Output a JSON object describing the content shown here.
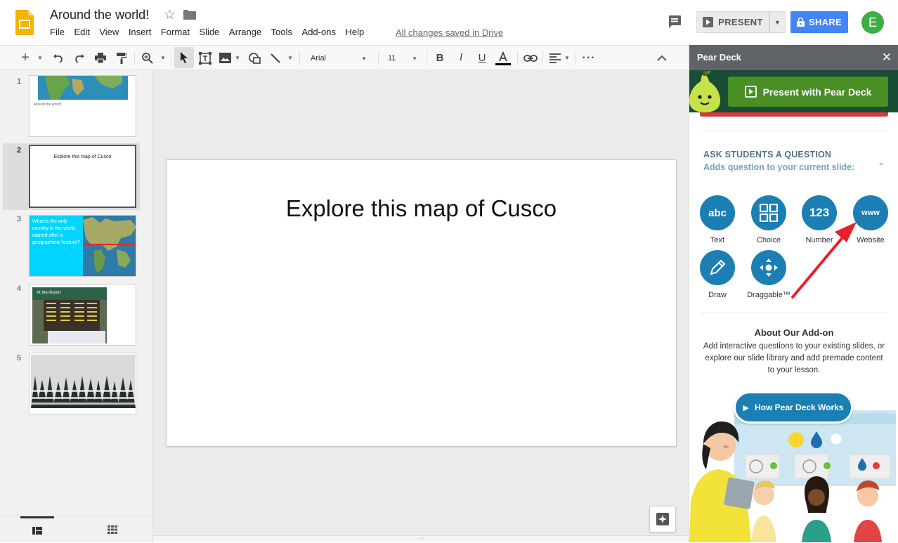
{
  "app": {
    "title": "Around the world!",
    "saved_status": "All changes saved in Drive",
    "menu": [
      "File",
      "Edit",
      "View",
      "Insert",
      "Format",
      "Slide",
      "Arrange",
      "Tools",
      "Add-ons",
      "Help"
    ],
    "present_label": "PRESENT",
    "share_label": "SHARE",
    "avatar_initial": "E"
  },
  "toolbar": {
    "font": "Arial",
    "font_size": "11",
    "icons": [
      "new-slide-icon",
      "undo-icon",
      "redo-icon",
      "print-icon",
      "paint-format-icon",
      "zoom-icon",
      "select-icon",
      "text-box-icon",
      "image-icon",
      "shape-icon",
      "line-icon",
      "bold-icon",
      "italic-icon",
      "underline-icon",
      "text-color-icon",
      "link-icon",
      "align-icon",
      "more-icon",
      "collapse-icon"
    ]
  },
  "filmstrip": {
    "slides": [
      {
        "number": "1",
        "text": "Around the world!"
      },
      {
        "number": "2",
        "text": "Explore this map of Cusco"
      },
      {
        "number": "3",
        "text": "What is the only country in the world named after a geographical feature?"
      },
      {
        "number": "4",
        "text": "At the Airport"
      },
      {
        "number": "5",
        "text": ""
      }
    ],
    "selected": 2
  },
  "canvas": {
    "slide_title": "Explore this map of Cusco"
  },
  "sidepanel": {
    "title": "Pear Deck",
    "present_button": "Present with Pear Deck",
    "ask_title": "ASK STUDENTS A QUESTION",
    "ask_subtitle": "Adds question to your current slide:",
    "question_types": [
      {
        "label": "Text",
        "glyph": "abc"
      },
      {
        "label": "Choice",
        "glyph": "grid"
      },
      {
        "label": "Number",
        "glyph": "123"
      },
      {
        "label": "Website",
        "glyph": "www"
      },
      {
        "label": "Draw",
        "glyph": "pencil"
      },
      {
        "label": "Draggable™",
        "glyph": "move"
      }
    ],
    "about_title": "About Our Add-on",
    "about_text": "Add interactive questions to your existing slides, or explore our slide library and add premade content to your lesson.",
    "how_button": "How Pear Deck Works"
  },
  "colors": {
    "share_blue": "#4285f4",
    "pear_green": "#4a8e26",
    "question_blue": "#1b7fb4",
    "annotation_red": "#e8202a"
  }
}
